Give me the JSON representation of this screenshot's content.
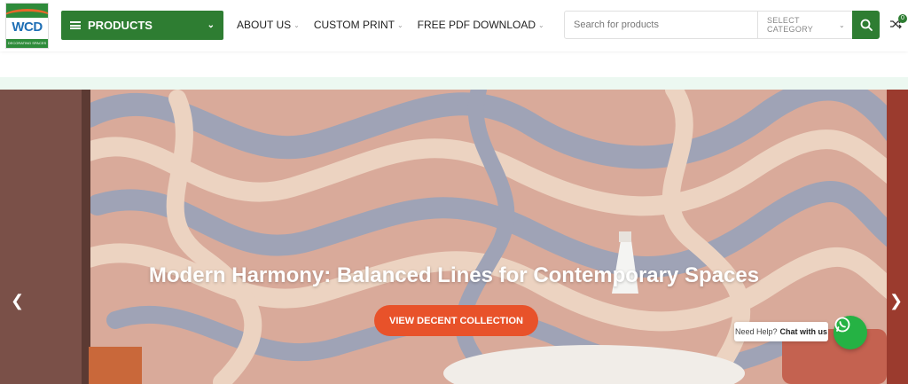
{
  "logo": {
    "brand": "WCD",
    "tagline": "DECORATING SPACES"
  },
  "header": {
    "products_label": "PRODUCTS",
    "nav": [
      {
        "label": "ABOUT US"
      },
      {
        "label": "CUSTOM PRINT"
      },
      {
        "label": "FREE PDF DOWNLOAD"
      }
    ],
    "search": {
      "placeholder": "Search for products",
      "category": "SELECT CATEGORY"
    },
    "compare_count": "0"
  },
  "hero": {
    "title": "Modern Harmony: Balanced Lines for Contemporary Spaces",
    "cta": "VIEW DECENT COLLECTION"
  },
  "help": {
    "prefix": "Need Help?",
    "strong": "Chat with us"
  },
  "colors": {
    "brand_green": "#2e7d32",
    "cta_orange": "#e8522a",
    "whatsapp": "#25b244"
  }
}
